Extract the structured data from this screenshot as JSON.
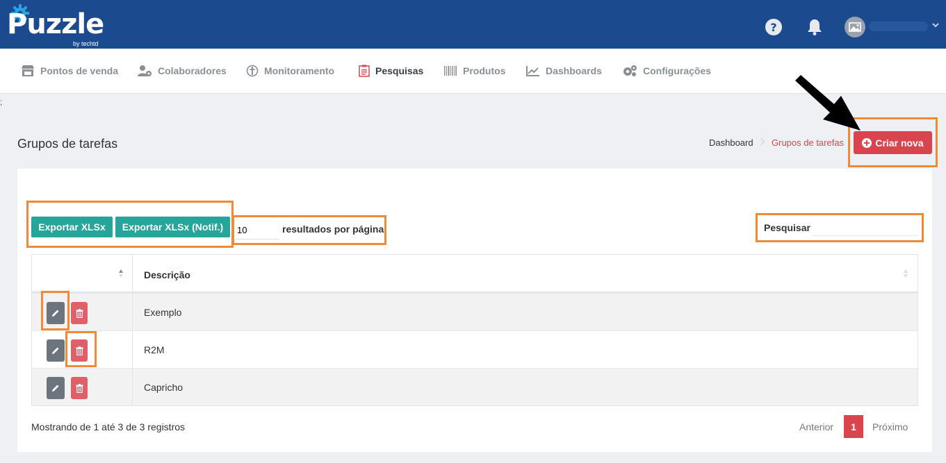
{
  "header": {
    "logo_text": "Puzzle",
    "logo_sub": "by techtd"
  },
  "nav": {
    "items": [
      {
        "label": "Pontos de venda",
        "icon": "store-icon"
      },
      {
        "label": "Colaboradores",
        "icon": "users-cog-icon"
      },
      {
        "label": "Monitoramento",
        "icon": "compass-icon"
      },
      {
        "label": "Pesquisas",
        "icon": "clipboard-list-icon"
      },
      {
        "label": "Produtos",
        "icon": "barcode-icon"
      },
      {
        "label": "Dashboards",
        "icon": "chart-line-icon"
      },
      {
        "label": "Configurações",
        "icon": "cogs-icon"
      }
    ],
    "active": "Pesquisas"
  },
  "stray_text": ";",
  "page": {
    "title": "Grupos de tarefas",
    "breadcrumb": [
      "Dashboard",
      "Grupos de tarefas"
    ],
    "new_button": "Criar nova"
  },
  "toolbar": {
    "export_xlsx": "Exportar XLSx",
    "export_xlsx_notif": "Exportar XLSx (Notif.)",
    "page_length": "10",
    "page_length_label": "resultados por página",
    "search_label": "Pesquisar",
    "search_value": ""
  },
  "table": {
    "columns": [
      "",
      "Descrição"
    ],
    "rows": [
      {
        "descricao": "Exemplo"
      },
      {
        "descricao": "R2M"
      },
      {
        "descricao": "Capricho"
      }
    ]
  },
  "footer": {
    "info": "Mostrando de 1 até 3 de 3 registros",
    "prev": "Anterior",
    "current_page": "1",
    "next": "Próximo"
  },
  "colors": {
    "header_bg": "#1c4a8f",
    "accent_red": "#d9454f",
    "teal": "#26a69a",
    "highlight_orange": "#f08a35"
  }
}
